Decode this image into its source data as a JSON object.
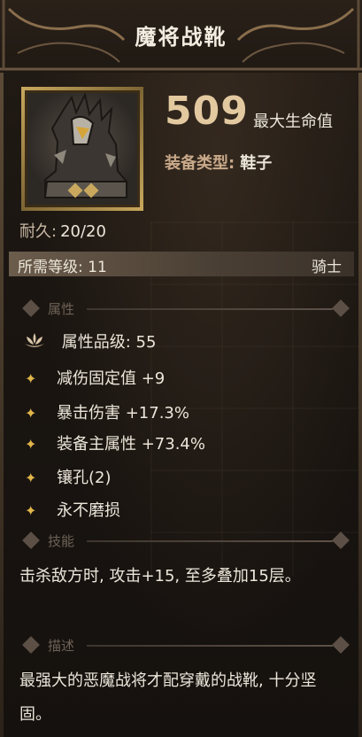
{
  "title": "魔将战靴",
  "main_stat": {
    "value": "509",
    "label": "最大生命值"
  },
  "equip_type": {
    "label": "装备类型:",
    "value": "鞋子"
  },
  "durability": {
    "label": "耐久:",
    "value": "20/20"
  },
  "requirement": {
    "text": "所需等级: 11",
    "class": "骑士"
  },
  "sections": {
    "attributes": "属性",
    "skill": "技能",
    "description": "描述"
  },
  "attribute_quality": "属性品级: 55",
  "attributes": [
    "减伤固定值 +9",
    "暴击伤害 +17.3%",
    "装备主属性 +73.4%",
    "镶孔(2)",
    "永不磨损"
  ],
  "skill_text": "击杀敌方时, 攻击+15, 至多叠加15层。",
  "description_text": "最强大的恶魔战将才配穿戴的战靴, 十分坚固。",
  "colors": {
    "gold": "#e3c9a0",
    "star": "#e0b54a",
    "text": "#ece6da",
    "muted": "#6e6257"
  },
  "icons": {
    "item": "demon-boot-icon",
    "quality": "lotus-icon",
    "bullet": "star-icon"
  }
}
